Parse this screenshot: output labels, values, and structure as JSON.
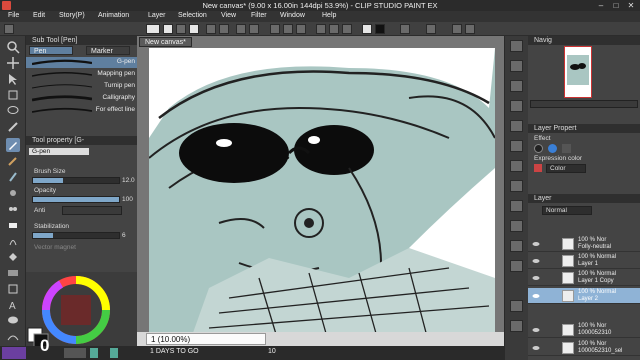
{
  "window": {
    "title": "New canvas* (9.00 x 16.00in 144dpi 53.9%) - CLIP STUDIO PAINT EX",
    "min": "–",
    "max": "□",
    "close": "✕"
  },
  "menu": [
    "File",
    "Edit",
    "Story(P)",
    "Animation",
    "Layer",
    "Selection",
    "View",
    "Filter",
    "Window",
    "Help"
  ],
  "sub_tool": {
    "header": "Sub Tool [Pen]",
    "tabs": [
      "Pen",
      "Marker"
    ],
    "brushes": [
      "G-pen",
      "Mapping pen",
      "Turnip pen",
      "Calligraphy",
      "For effect line"
    ]
  },
  "tool_property": {
    "header": "Tool property [G-",
    "tool_name": "G-pen",
    "brush_size_label": "Brush Size",
    "brush_size_value": "12.0",
    "opacity_label": "Opacity",
    "opacity_value": "100",
    "opacity_level": 1.0,
    "brush_size_level": 0.35,
    "anti_label": "Anti",
    "stabilization_label": "Stabilization",
    "stabilization_value": "6",
    "vector_label": "Vector magnet"
  },
  "canvas": {
    "tab_label": "New canvas*",
    "zoom": "1 (10.00%)"
  },
  "timeline": {
    "days_label": "1 DAYS TO GO",
    "frame": "10",
    "counter": "0"
  },
  "navigator": {
    "header": "Navig"
  },
  "layer_property": {
    "header": "Layer Propert",
    "effect_label": "Effect",
    "expression_label": "Expression color",
    "color_value": "Color"
  },
  "layers": {
    "header": "Layer",
    "blend": "Normal",
    "rows": [
      {
        "l1": "100 % Nor",
        "l2": "Folly-neutral"
      },
      {
        "l1": "100 % Normal",
        "l2": "Layer 1"
      },
      {
        "l1": "100 % Normal",
        "l2": "Layer 1 Copy"
      },
      {
        "l1": "100 % Normal",
        "l2": "Layer 2"
      },
      {
        "l1": "100 % Nor",
        "l2": "1000052310"
      },
      {
        "l1": "100 % Nor",
        "l2": "1000052310_sel"
      }
    ]
  },
  "colors": {
    "sketch_fill": "#a9c6c2",
    "accent": "#7fa7c9"
  }
}
